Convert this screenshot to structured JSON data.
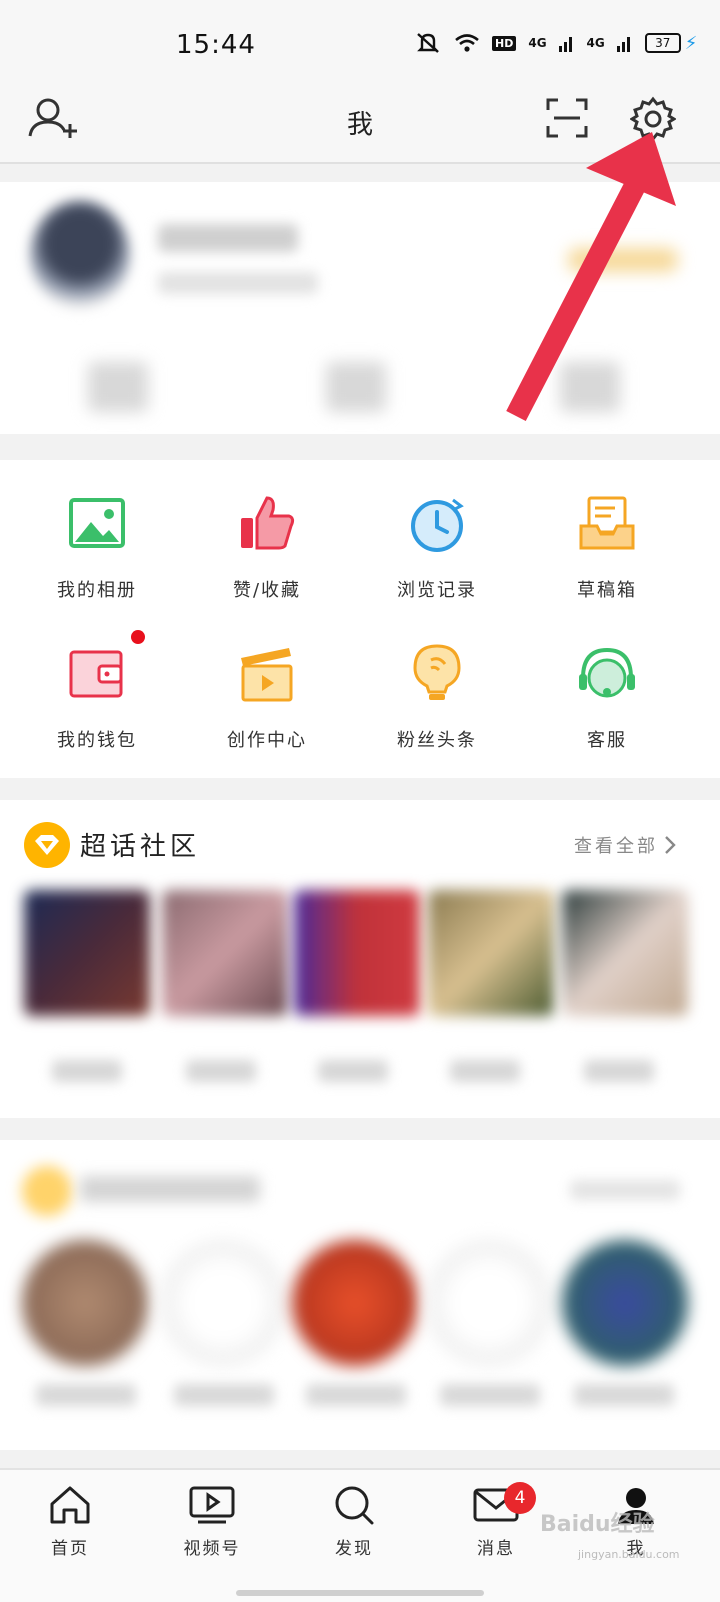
{
  "status_bar": {
    "time": "15:44",
    "network_tag": "HD",
    "signal_1": "4G",
    "signal_2": "4G",
    "battery": "37"
  },
  "header": {
    "title": "我"
  },
  "grid": [
    {
      "label": "我的相册",
      "icon": "photo-album-icon"
    },
    {
      "label": "赞/收藏",
      "icon": "thumbs-up-icon"
    },
    {
      "label": "浏览记录",
      "icon": "history-clock-icon"
    },
    {
      "label": "草稿箱",
      "icon": "drafts-box-icon"
    },
    {
      "label": "我的钱包",
      "icon": "wallet-icon"
    },
    {
      "label": "创作中心",
      "icon": "clapperboard-icon"
    },
    {
      "label": "粉丝头条",
      "icon": "lightbulb-icon"
    },
    {
      "label": "客服",
      "icon": "headset-icon"
    }
  ],
  "super_topic": {
    "title": "超话社区",
    "more": "查看全部"
  },
  "tabs": [
    {
      "label": "首页",
      "icon": "home-icon"
    },
    {
      "label": "视频号",
      "icon": "video-icon"
    },
    {
      "label": "发现",
      "icon": "search-icon"
    },
    {
      "label": "消息",
      "icon": "mail-icon",
      "badge": "4"
    },
    {
      "label": "我",
      "icon": "profile-icon"
    }
  ],
  "watermark": {
    "text": "Baidu经验",
    "sub": "jingyan.baidu.com"
  },
  "colors": {
    "accent_red": "#e8272c",
    "arrow_red": "#e8324a",
    "topic_gold": "#ffb400"
  }
}
